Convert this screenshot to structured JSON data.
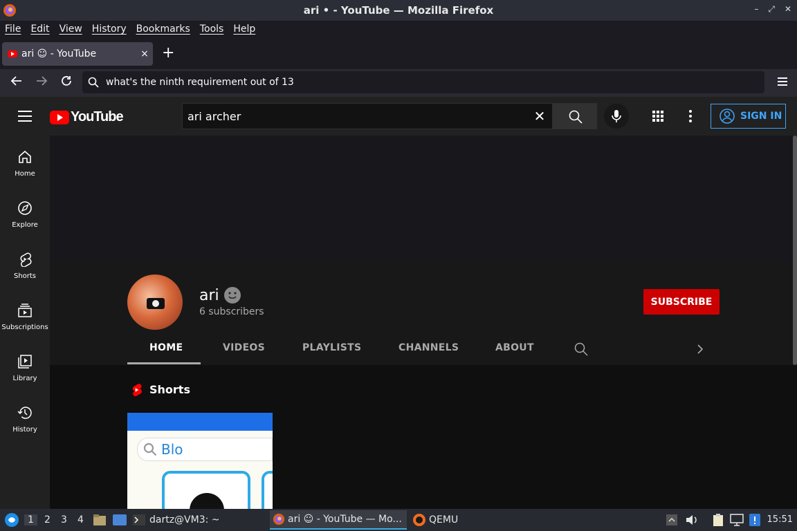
{
  "window": {
    "title": "ari • - YouTube — Mozilla Firefox",
    "buttons": [
      "minimize",
      "maximize",
      "close"
    ]
  },
  "menubar": {
    "items": [
      "File",
      "Edit",
      "View",
      "History",
      "Bookmarks",
      "Tools",
      "Help"
    ]
  },
  "tabs": [
    {
      "title": "ari ☺ - YouTube",
      "close": "×"
    }
  ],
  "newtab": "+",
  "urlbar": {
    "value": "what's the ninth requirement out of 13"
  },
  "youtube": {
    "logo_text": "YouTube",
    "search_query": "ari archer",
    "signin_label": "SIGN IN",
    "sidebar": [
      {
        "label": "Home",
        "icon": "home-icon"
      },
      {
        "label": "Explore",
        "icon": "compass-icon"
      },
      {
        "label": "Shorts",
        "icon": "shorts-icon"
      },
      {
        "label": "Subscriptions",
        "icon": "subscriptions-icon"
      },
      {
        "label": "Library",
        "icon": "library-icon"
      },
      {
        "label": "History",
        "icon": "history-icon"
      }
    ],
    "channel": {
      "name": "ari",
      "subscribers": "6 subscribers",
      "subscribe_label": "SUBSCRIBE",
      "tabs": [
        "HOME",
        "VIDEOS",
        "PLAYLISTS",
        "CHANNELS",
        "ABOUT"
      ],
      "active_tab": "HOME"
    },
    "shelf_title": "Shorts",
    "short_thumb_text": "Blo"
  },
  "taskbar": {
    "workspaces": [
      "1",
      "2",
      "3",
      "4"
    ],
    "tasks": [
      {
        "label": "dartz@VM3: ~",
        "icon": "terminal-icon"
      },
      {
        "label": "ari ☺ - YouTube — Mo...",
        "icon": "firefox-icon"
      },
      {
        "label": "QEMU",
        "icon": "qemu-icon"
      }
    ],
    "clock": "15:51"
  },
  "colors": {
    "youtube_red": "#ff0000",
    "subscribe_red": "#cc0000",
    "signin_blue": "#3ea6ff",
    "background": "#0f0f0f"
  }
}
